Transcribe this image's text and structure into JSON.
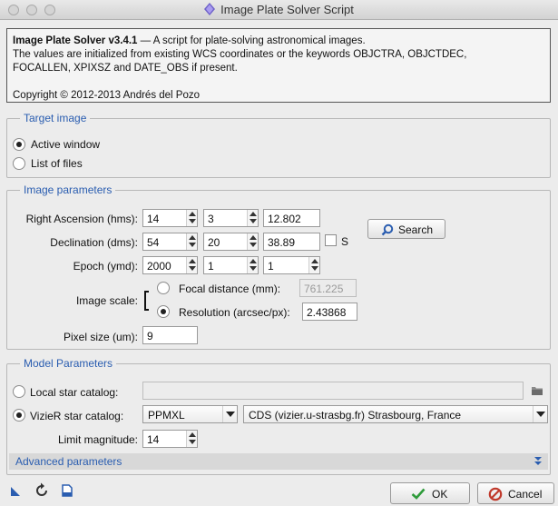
{
  "window": {
    "title": "Image Plate Solver Script"
  },
  "header": {
    "name": "Image Plate Solver v3.4.1",
    "description": "— A script for plate-solving astronomical images.",
    "line2": "The values are initialized from existing WCS coordinates or the keywords OBJCTRA, OBJCTDEC,",
    "line3": "FOCALLEN, XPIXSZ and DATE_OBS if present.",
    "copyright": "Copyright © 2012-2013 Andrés del Pozo"
  },
  "target_image": {
    "title": "Target image",
    "active_window": "Active window",
    "list_of_files": "List of files",
    "selected": "active_window"
  },
  "image_parameters": {
    "title": "Image parameters",
    "ra_label": "Right Ascension (hms):",
    "ra_h": "14",
    "ra_m": "3",
    "ra_s": "12.802",
    "dec_label": "Declination (dms):",
    "dec_d": "54",
    "dec_m": "20",
    "dec_s": "38.89",
    "south_label": "S",
    "south_checked": false,
    "epoch_label": "Epoch (ymd):",
    "epoch_y": "2000",
    "epoch_m": "1",
    "epoch_d": "1",
    "search_label": "Search",
    "scale_label": "Image scale:",
    "focal_label": "Focal distance (mm):",
    "focal_value": "761.225",
    "resolution_label": "Resolution (arcsec/px):",
    "resolution_value": "2.43868",
    "scale_mode": "resolution",
    "pixel_label": "Pixel size (um):",
    "pixel_value": "9"
  },
  "model_parameters": {
    "title": "Model Parameters",
    "local_label": "Local star catalog:",
    "local_value": "",
    "vizier_label": "VizieR star catalog:",
    "vizier_catalog": "PPMXL",
    "vizier_server": "CDS (vizier.u-strasbg.fr) Strasbourg, France",
    "catalog_mode": "vizier",
    "limit_label": "Limit magnitude:",
    "limit_value": "14",
    "advanced_label": "Advanced parameters"
  },
  "footer": {
    "ok_label": "OK",
    "cancel_label": "Cancel"
  },
  "colors": {
    "accent": "#2a5db0",
    "ok_green": "#2e9b3a",
    "cancel_red": "#c0392b"
  },
  "icons": [
    "new-instance-icon",
    "reset-icon",
    "documentation-icon",
    "folder-icon",
    "magnifier-icon",
    "double-chevron-down-icon",
    "checkmark-icon",
    "cancel-icon"
  ]
}
